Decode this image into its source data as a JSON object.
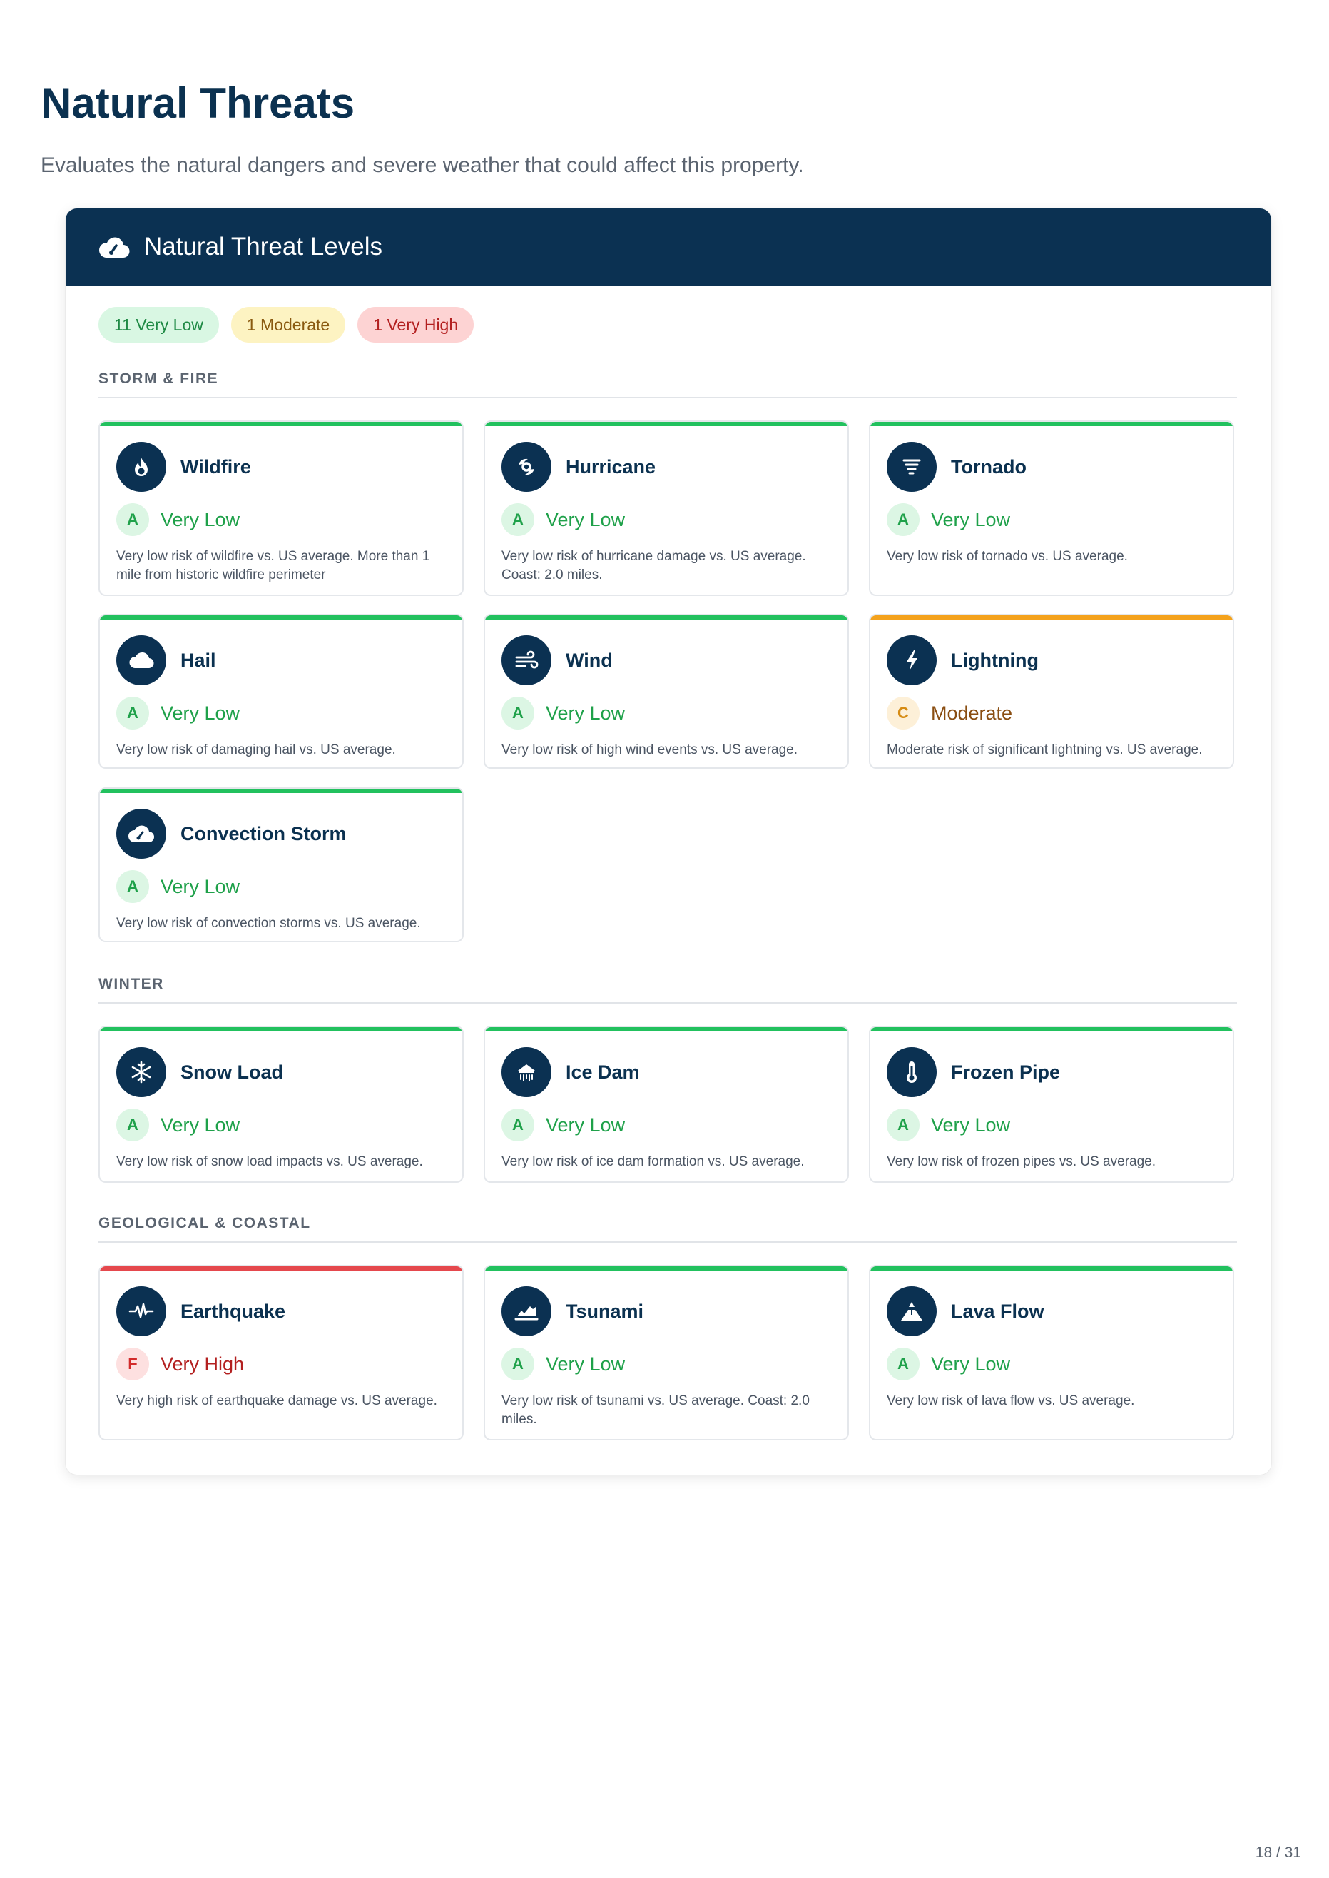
{
  "page": {
    "title": "Natural Threats",
    "subtitle": "Evaluates the natural dangers and severe weather that could affect this property.",
    "page_number": "18 / 31"
  },
  "panel": {
    "title": "Natural Threat Levels",
    "icon": "cloud-gauge-icon"
  },
  "summary": {
    "very_low": "11 Very Low",
    "moderate": "1 Moderate",
    "very_high": "1 Very High"
  },
  "colors": {
    "navy": "#0b3152",
    "green": "#22c15e",
    "orange": "#f4a21c",
    "red": "#e5484d"
  },
  "sections": [
    {
      "title": "STORM & FIRE",
      "cards": [
        {
          "name": "Wildfire",
          "icon": "fire-icon",
          "grade": "A",
          "level": "Very Low",
          "status": "green",
          "desc": "Very low risk of wildfire vs. US average. More than 1 mile from historic wildfire perimeter"
        },
        {
          "name": "Hurricane",
          "icon": "hurricane-icon",
          "grade": "A",
          "level": "Very Low",
          "status": "green",
          "desc": "Very low risk of hurricane damage vs. US average. Coast: 2.0 miles."
        },
        {
          "name": "Tornado",
          "icon": "tornado-icon",
          "grade": "A",
          "level": "Very Low",
          "status": "green",
          "desc": "Very low risk of tornado vs. US average."
        },
        {
          "name": "Hail",
          "icon": "cloud-icon",
          "grade": "A",
          "level": "Very Low",
          "status": "green",
          "desc": "Very low risk of damaging hail vs. US average."
        },
        {
          "name": "Wind",
          "icon": "wind-icon",
          "grade": "A",
          "level": "Very Low",
          "status": "green",
          "desc": "Very low risk of high wind events vs. US average."
        },
        {
          "name": "Lightning",
          "icon": "lightning-icon",
          "grade": "C",
          "level": "Moderate",
          "status": "orange",
          "desc": "Moderate risk of significant lightning vs. US average."
        },
        {
          "name": "Convection Storm",
          "icon": "cloud-gauge-icon",
          "grade": "A",
          "level": "Very Low",
          "status": "green",
          "desc": "Very low risk of convection storms vs. US average."
        }
      ]
    },
    {
      "title": "WINTER",
      "cards": [
        {
          "name": "Snow Load",
          "icon": "snowflake-icon",
          "grade": "A",
          "level": "Very Low",
          "status": "green",
          "desc": "Very low risk of snow load impacts vs. US average."
        },
        {
          "name": "Ice Dam",
          "icon": "house-icicles-icon",
          "grade": "A",
          "level": "Very Low",
          "status": "green",
          "desc": "Very low risk of ice dam formation vs. US average."
        },
        {
          "name": "Frozen Pipe",
          "icon": "thermometer-icon",
          "grade": "A",
          "level": "Very Low",
          "status": "green",
          "desc": "Very low risk of frozen pipes vs. US average."
        }
      ]
    },
    {
      "title": "GEOLOGICAL & COASTAL",
      "cards": [
        {
          "name": "Earthquake",
          "icon": "seismic-wave-icon",
          "grade": "F",
          "level": "Very High",
          "status": "red",
          "desc": "Very high risk of earthquake damage vs. US average."
        },
        {
          "name": "Tsunami",
          "icon": "wave-chart-icon",
          "grade": "A",
          "level": "Very Low",
          "status": "green",
          "desc": "Very low risk of tsunami vs. US average. Coast: 2.0 miles."
        },
        {
          "name": "Lava Flow",
          "icon": "volcano-icon",
          "grade": "A",
          "level": "Very Low",
          "status": "green",
          "desc": "Very low risk of lava flow vs. US average."
        }
      ]
    }
  ]
}
